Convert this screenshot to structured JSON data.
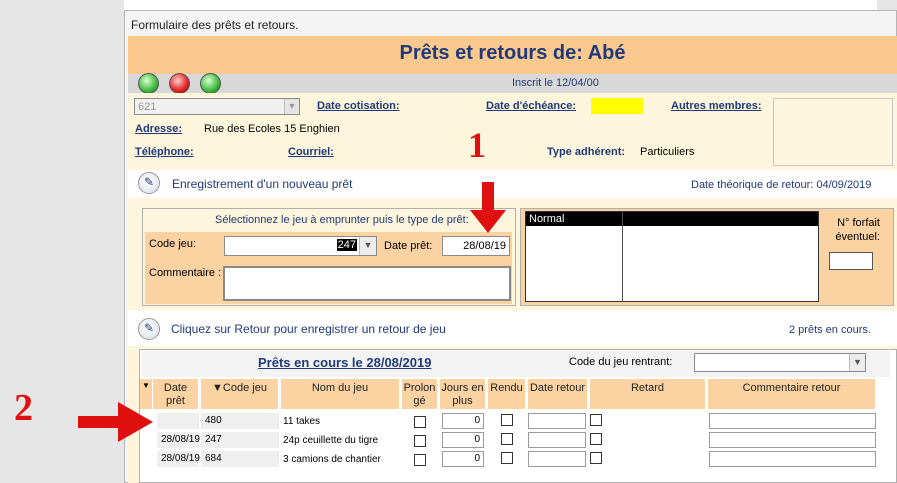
{
  "left_panel_color": "#e6e6e6",
  "window": {
    "title": "Formulaire des prêts et retours."
  },
  "header": {
    "title": "Prêts et retours de:  Abé",
    "subtitle": "Inscrit le 12/04/00"
  },
  "member": {
    "number": "621",
    "date_cotisation_label": "Date cotisation:",
    "date_echeance_label": "Date d'échéance:",
    "autres_membres_label": "Autres membres:",
    "adresse_label": "Adresse:",
    "adresse_value": "Rue des Ecoles 15 Enghien",
    "telephone_label": "Téléphone:",
    "courriel_label": "Courriel:",
    "type_label": "Type adhérent:",
    "type_value": "Particuliers"
  },
  "annotations": {
    "marker1": "1",
    "marker2": "2"
  },
  "loan": {
    "section_title": "Enregistrement d'un nouveau prêt",
    "date_theorique": "Date théorique de retour: 04/09/2019",
    "instruction": "Sélectionnez le jeu à emprunter puis le type de prêt:",
    "code_jeu_label": "Code jeu:",
    "code_jeu_value": "247",
    "date_pret_label": "Date prêt:",
    "date_pret_value": "28/08/19",
    "commentaire_label": "Commentaire :",
    "type_list_item": "Normal",
    "forfait_label": "N° forfait éventuel:"
  },
  "returns": {
    "section_title": "Cliquez sur Retour pour enregistrer un retour de jeu",
    "count_text": "2 prêts en cours.",
    "table_title": "Prêts en cours le 28/08/2019",
    "code_rentrant_label": "Code du jeu rentrant:",
    "columns": {
      "date_pret": "Date prêt",
      "code_jeu": "▼Code jeu",
      "nom": "Nom du jeu",
      "prolonge": "Prolon gé",
      "jours": "Jours en plus",
      "rendu": "Rendu",
      "date_retour": "Date retour",
      "retard": "Retard",
      "commentaire": "Commentaire retour"
    },
    "rows": [
      {
        "date": "",
        "code": "480",
        "nom": "11 takes",
        "jours": "0"
      },
      {
        "date": "28/08/19",
        "code": "247",
        "nom": "24p ceuillette du tigre",
        "jours": "0"
      },
      {
        "date": "28/08/19",
        "code": "684",
        "nom": "3 camions de chantier",
        "jours": "0"
      }
    ]
  }
}
